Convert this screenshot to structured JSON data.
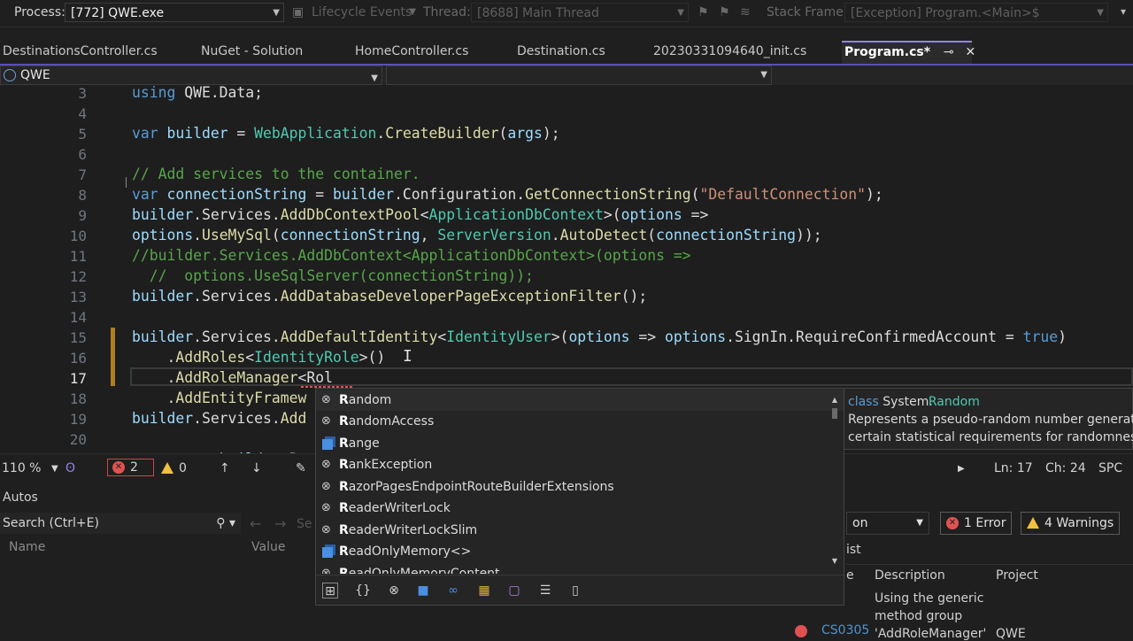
{
  "debug_toolbar": {
    "process_label": "Process:",
    "process_value": "[772] QWE.exe",
    "lifecycle_label": "Lifecycle Events",
    "thread_label": "Thread:",
    "thread_value": "[8688] Main Thread",
    "stack_label": "Stack Frame:",
    "stack_value": "[Exception] Program.<Main>$"
  },
  "tabs": [
    {
      "label": "DestinationsController.cs"
    },
    {
      "label": "NuGet - Solution"
    },
    {
      "label": "HomeController.cs"
    },
    {
      "label": "Destination.cs"
    },
    {
      "label": "20230331094640_init.cs"
    },
    {
      "label": "Program.cs*",
      "active": true
    }
  ],
  "navbar": {
    "project": "QWE"
  },
  "editor": {
    "line_numbers": [
      "3",
      "4",
      "5",
      "6",
      "7",
      "8",
      "9",
      "10",
      "11",
      "12",
      "13",
      "14",
      "15",
      "16",
      "17",
      "18",
      "19",
      "20"
    ],
    "current_line": "17"
  },
  "status": {
    "zoom": "110 %",
    "errors": "2",
    "warnings": "0",
    "ln": "Ln: 17",
    "ch": "Ch: 24",
    "mode": "SPC"
  },
  "autos": {
    "title": "Autos",
    "search_placeholder": "Search (Ctrl+E)",
    "col_name": "Name",
    "col_value": "Value",
    "partial_search": "Se"
  },
  "completion": {
    "items": [
      {
        "hl": "R",
        "rest": "andom",
        "kind": "class",
        "selected": true
      },
      {
        "hl": "R",
        "rest": "andomAccess",
        "kind": "class"
      },
      {
        "hl": "R",
        "rest": "ange",
        "kind": "struct"
      },
      {
        "hl": "R",
        "rest": "ankException",
        "kind": "class"
      },
      {
        "hl": "R",
        "rest": "azorPagesEndpointRouteBuilderExtensions",
        "kind": "class"
      },
      {
        "hl": "R",
        "rest": "eaderWriterLock",
        "kind": "class"
      },
      {
        "hl": "R",
        "rest": "eaderWriterLockSlim",
        "kind": "class"
      },
      {
        "hl": "R",
        "rest": "eadOnlyMemory<>",
        "kind": "struct"
      },
      {
        "hl": "R",
        "rest": "eadOnlyMemoryContent",
        "kind": "class"
      }
    ]
  },
  "tooltip": {
    "kw": "class",
    "ns": "System.",
    "type": "Random",
    "line2": "Represents a pseudo-random number generator,",
    "line3": "certain statistical requirements for randomness."
  },
  "error_list": {
    "scope_partial": "on",
    "errors_btn": "1 Error",
    "warnings_btn": "4 Warnings",
    "title_partial": "ist",
    "col_e": "e",
    "col_description": "Description",
    "col_project": "Project",
    "desc_line1": "Using the generic",
    "desc_line2": "method group",
    "desc_line3": "'AddRoleManager'",
    "code": "CS0305",
    "project": "QWE"
  },
  "colors": {
    "accent": "#9184ee",
    "keyword": "#569cd6",
    "type": "#4ec9b0",
    "method": "#dcdcaa",
    "string": "#ce9178",
    "comment": "#57a64a",
    "error": "#e05252",
    "warning": "#f0c040"
  }
}
